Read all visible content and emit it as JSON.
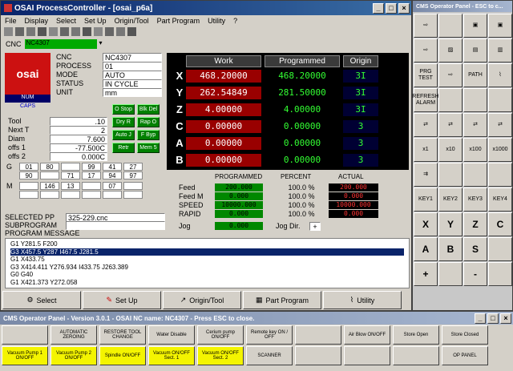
{
  "main_window": {
    "title": "OSAI ProcessController - [osai_p6a]",
    "menu": [
      "File",
      "Display",
      "Select",
      "Set Up",
      "Origin/Tool",
      "Part Program",
      "Utility",
      "?"
    ],
    "cnc_label": "CNC",
    "cnc_value": "NC4307"
  },
  "status": {
    "labels": [
      "CNC",
      "PROCESS",
      "MODE",
      "STATUS",
      "UNIT"
    ],
    "values": [
      "NC4307",
      "01",
      "AUTO",
      "IN CYCLE",
      "mm"
    ],
    "logo": "osai",
    "num": "NUM",
    "caps": "CAPS"
  },
  "mini_buttons": [
    "O Stop",
    "Blk Del",
    "Dry R",
    "Rap O",
    "Auto J",
    "F Byp",
    "Retr",
    "Mem 5"
  ],
  "tool": {
    "labels": [
      "Tool",
      "Next T",
      "Diam",
      "offs 1",
      "offs 2"
    ],
    "values": [
      ".10",
      "2",
      "7.600",
      "-77.500C",
      "0.000C"
    ]
  },
  "gcodes": {
    "g_label": "G",
    "row1": [
      "01",
      "80",
      "",
      "99",
      "41",
      "27"
    ],
    "row2": [
      "90",
      "",
      "71",
      "17",
      "94",
      "97"
    ],
    "m_label": "M",
    "mrow": [
      "",
      "146",
      "13",
      "",
      "07",
      ""
    ]
  },
  "axes": {
    "headers": [
      "Work",
      "Programmed",
      "Origin"
    ],
    "rows": [
      {
        "name": "X",
        "work": "468.20000",
        "prog": "468.20000",
        "origin": "3I"
      },
      {
        "name": "Y",
        "work": "262.54849",
        "prog": "281.50000",
        "origin": "3I"
      },
      {
        "name": "Z",
        "work": "4.00000",
        "prog": "4.00000",
        "origin": "3I"
      },
      {
        "name": "C",
        "work": "0.00000",
        "prog": "0.00000",
        "origin": "3"
      },
      {
        "name": "A",
        "work": "0.00000",
        "prog": "0.00000",
        "origin": "3"
      },
      {
        "name": "B",
        "work": "0.00000",
        "prog": "0.00000",
        "origin": "3"
      }
    ]
  },
  "feed": {
    "headers": [
      "PROGRAMMED",
      "PERCENT",
      "ACTUAL"
    ],
    "rows": [
      {
        "label": "Feed",
        "prog": "200.000",
        "pct": "100.0 %",
        "act": "200.000"
      },
      {
        "label": "Feed  M",
        "prog": "0.000",
        "pct": "100.0 %",
        "act": "0.000"
      },
      {
        "label": "SPEED",
        "prog": "10000.000",
        "pct": "100.0 %",
        "act": "10000.000"
      },
      {
        "label": "RAPID",
        "prog": "0.000",
        "pct": "100.0 %",
        "act": "0.000"
      }
    ],
    "jog_label": "Jog",
    "jog_value": "0.000",
    "jogdir_label": "Jog Dir.",
    "jogdir_value": "+"
  },
  "program": {
    "selected_label": "SELECTED PP",
    "selected_value": "325-229.cnc",
    "sub_label": "SUBPROGRAM",
    "msg_label": "PROGRAM MESSAGE",
    "lines": [
      "G1 Y281.5 F200",
      "G3 X457.5 Y287 I467.5 J281.5",
      "G1 X433.75",
      "G3 X414.411 Y276.934 I433.75 J263.389",
      "G0 G40",
      "G1 X421.373 Y272.058"
    ],
    "selected_line": 1
  },
  "bottom_bar": [
    "Select",
    "Set Up",
    "Origin/Tool",
    "Part Program",
    "Utility"
  ],
  "op_panel": {
    "title": "CMS Operator Panel - ESC to c...",
    "rows": [
      [
        "",
        "",
        "",
        ""
      ],
      [
        "",
        "",
        "",
        ""
      ],
      [
        "PRG TEST",
        "",
        "PATH",
        ""
      ],
      [
        "REFRESH ALARM",
        "",
        "",
        ""
      ],
      [
        "",
        "",
        "",
        ""
      ],
      [
        "x1",
        "x10",
        "x100",
        "x1000"
      ],
      [
        "",
        "",
        "",
        ""
      ],
      [
        "KEY1",
        "KEY2",
        "KEY3",
        "KEY4"
      ],
      [
        "X",
        "Y",
        "Z",
        "C"
      ],
      [
        "A",
        "B",
        "S",
        ""
      ],
      [
        "+",
        "",
        "-",
        ""
      ]
    ]
  },
  "cms_bar": {
    "title": "CMS Operator Panel - Version 3.0.1  -  OSAI NC name: NC4307  -  Press ESC to close.",
    "row1": [
      "",
      "AUTOMATIC ZEROING",
      "RESTORE TOOL CHANGE",
      "Water Disable",
      "Cerium pump ON/OFF",
      "Remote key   ON / OFF",
      "",
      "Air Blow ON/OFF",
      "Store Open",
      "Store Closed"
    ],
    "row2": [
      "Vacuum Pump 1 ON/OFF",
      "Vacuum Pump 2 ON/OFF",
      "Spindle ON/OFF",
      "Vacuum ON/OFF Sect. 1",
      "Vacuum ON/OFF Sect. 2",
      "SCANNER",
      "",
      "",
      "",
      "OP PANEL"
    ]
  }
}
